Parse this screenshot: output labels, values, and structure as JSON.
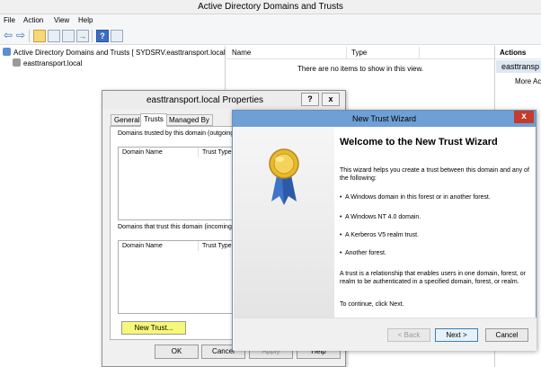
{
  "window": {
    "title": "Active Directory Domains and Trusts",
    "menu": [
      "File",
      "Action",
      "View",
      "Help"
    ],
    "toolbar_icons": [
      "back-arrow-icon",
      "forward-arrow-icon",
      "up-folder-icon",
      "show-hide-tree-icon",
      "properties-icon",
      "export-list-icon",
      "help-icon",
      "console-pane-icon"
    ]
  },
  "tree": {
    "root": "Active Directory Domains and Trusts [ SYDSRV.easttransport.local ]",
    "child": "easttransport.local"
  },
  "list": {
    "columns": [
      "Name",
      "Type"
    ],
    "empty_message": "There are no items to show in this view."
  },
  "actions": {
    "header": "Actions",
    "selected": "easttransp",
    "more": "More Ac"
  },
  "properties": {
    "title": "easttransport.local Properties",
    "help_btn": "?",
    "close_btn": "x",
    "tabs": [
      "General",
      "Trusts",
      "Managed By"
    ],
    "outgoing_label": "Domains trusted by this domain (outgoing",
    "incoming_label": "Domains that trust this domain (incoming",
    "col_domain": "Domain Name",
    "col_type": "Trust Type",
    "new_trust": "New Trust...",
    "ok": "OK",
    "cancel": "Cancel",
    "apply": "Apply",
    "help": "Help"
  },
  "wizard": {
    "title": "New Trust Wizard",
    "close": "x",
    "heading": "Welcome to the New Trust Wizard",
    "intro": "This wizard helps you create a trust between this domain and any of the following:",
    "bullets": [
      "A Windows domain in this forest or in another forest.",
      "A Windows NT 4.0 domain.",
      "A Kerberos V5 realm trust.",
      "Another forest."
    ],
    "bullet_glyph": "•",
    "para": "A trust is a relationship that enables users in one domain, forest, or realm to be authenticated in a specified domain, forest, or realm.",
    "continue": "To continue, click Next.",
    "back": "< Back",
    "next": "Next >",
    "cancel": "Cancel",
    "badge_icon": "award-ribbon-icon",
    "title_color": "#6ea0d6",
    "highlight_color": "#f7f77a"
  }
}
